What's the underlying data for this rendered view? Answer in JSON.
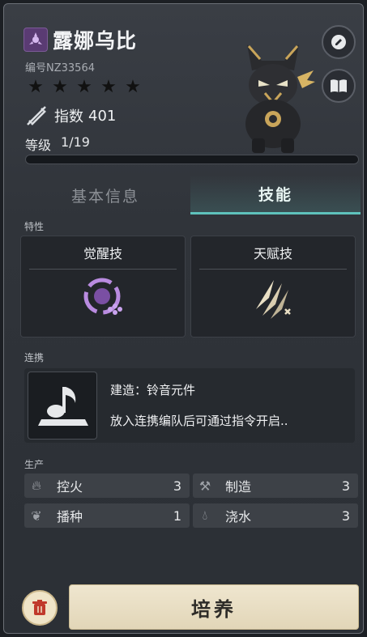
{
  "pal": {
    "name": "露娜乌比",
    "id_text": "编号NZ33564",
    "stars": 5,
    "index_label": "指数",
    "index_value": "401",
    "level_label": "等级",
    "level_value": "1/19",
    "level_progress": 0.0,
    "element_icon": "neutral-dark-element-icon"
  },
  "side_buttons": {
    "rename_icon": "edit-icon",
    "book_icon": "book-icon"
  },
  "tabs": [
    {
      "label": "基本信息",
      "active": false
    },
    {
      "label": "技能",
      "active": true
    }
  ],
  "traits": {
    "section_label": "特性",
    "awaken": {
      "title": "觉醒技",
      "icon": "awaken-skill-icon"
    },
    "talent": {
      "title": "天赋技",
      "icon": "talent-skill-icon"
    }
  },
  "link": {
    "section_label": "连携",
    "title": "建造：铃音元件",
    "desc": "放入连携编队后可通过指令开启..",
    "icon": "music-note-icon"
  },
  "production": {
    "section_label": "生产",
    "items": [
      {
        "name": "控火",
        "level": "3",
        "icon": "fire-icon"
      },
      {
        "name": "制造",
        "level": "3",
        "icon": "hammer-icon"
      },
      {
        "name": "播种",
        "level": "1",
        "icon": "sprout-icon"
      },
      {
        "name": "浇水",
        "level": "3",
        "icon": "water-drops-icon"
      }
    ]
  },
  "actions": {
    "train_label": "培养",
    "delete_icon": "trash-icon"
  },
  "colors": {
    "accent": "#5ec2bc",
    "skill_purple": "#b98be0",
    "button_cream": "#efe6cf"
  }
}
